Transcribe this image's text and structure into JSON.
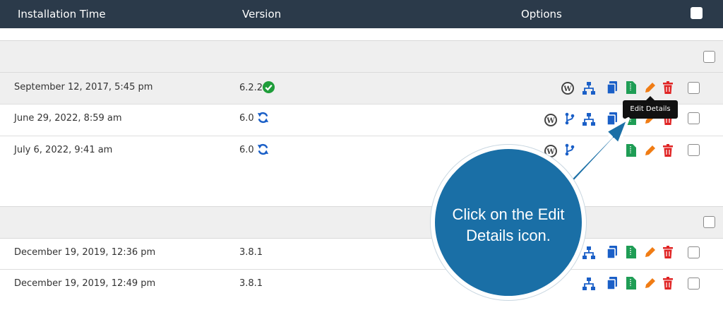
{
  "header": {
    "installation_time": "Installation Time",
    "version": "Version",
    "options": "Options"
  },
  "rows": [
    {
      "date": "September 12, 2017, 5:45 pm",
      "version": "6.2.2",
      "status_icon": "check-circle-icon"
    },
    {
      "date": "June 29, 2022, 8:59 am",
      "version": "6.0",
      "status_icon": "sync-icon"
    },
    {
      "date": "July 6, 2022, 9:41 am",
      "version": "6.0",
      "status_icon": "sync-icon"
    },
    {
      "date": "December 19, 2019, 12:36 pm",
      "version": "3.8.1"
    },
    {
      "date": "December 19, 2019, 12:49 pm",
      "version": "3.8.1"
    }
  ],
  "tooltip": {
    "text": "Edit Details"
  },
  "callout": {
    "line1": "Click on the Edit",
    "line2": "Details icon."
  },
  "colors": {
    "header_bg": "#2b3a4a",
    "blue_icon": "#1a5fc7",
    "green_icon": "#1f9d55",
    "orange_icon": "#f07c14",
    "red_icon": "#e02424",
    "callout_bg": "#1a6fa6"
  }
}
